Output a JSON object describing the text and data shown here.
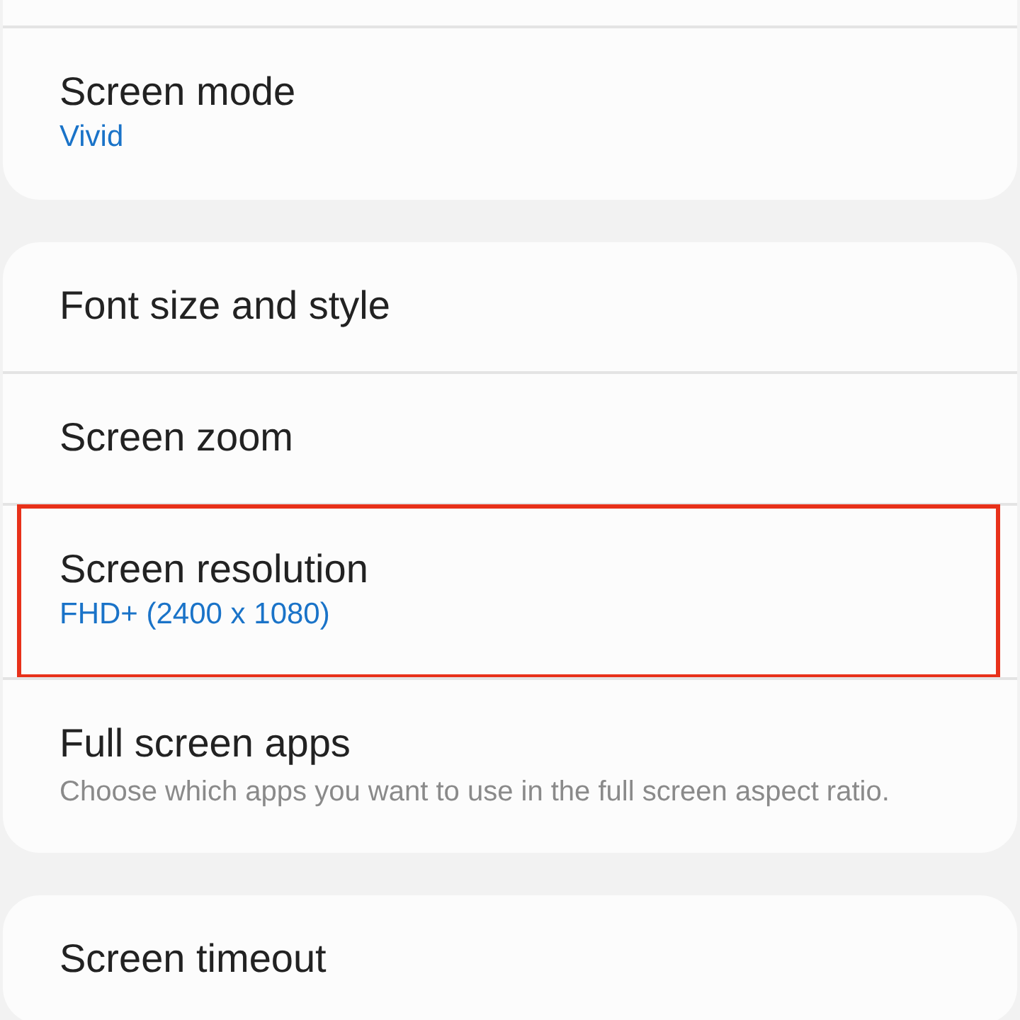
{
  "groups": [
    {
      "items": [
        {
          "title": "Screen mode",
          "value": "Vivid",
          "highlighted": false
        }
      ],
      "cut_top": true
    },
    {
      "items": [
        {
          "title": "Font size and style",
          "highlighted": false
        },
        {
          "title": "Screen zoom",
          "highlighted": false
        },
        {
          "title": "Screen resolution",
          "value": "FHD+ (2400 x 1080)",
          "highlighted": true
        },
        {
          "title": "Full screen apps",
          "description": "Choose which apps you want to use in the full screen aspect ratio.",
          "highlighted": false
        }
      ],
      "cut_top": false
    },
    {
      "items": [
        {
          "title": "Screen timeout",
          "highlighted": false
        }
      ],
      "cut_top": false
    }
  ]
}
